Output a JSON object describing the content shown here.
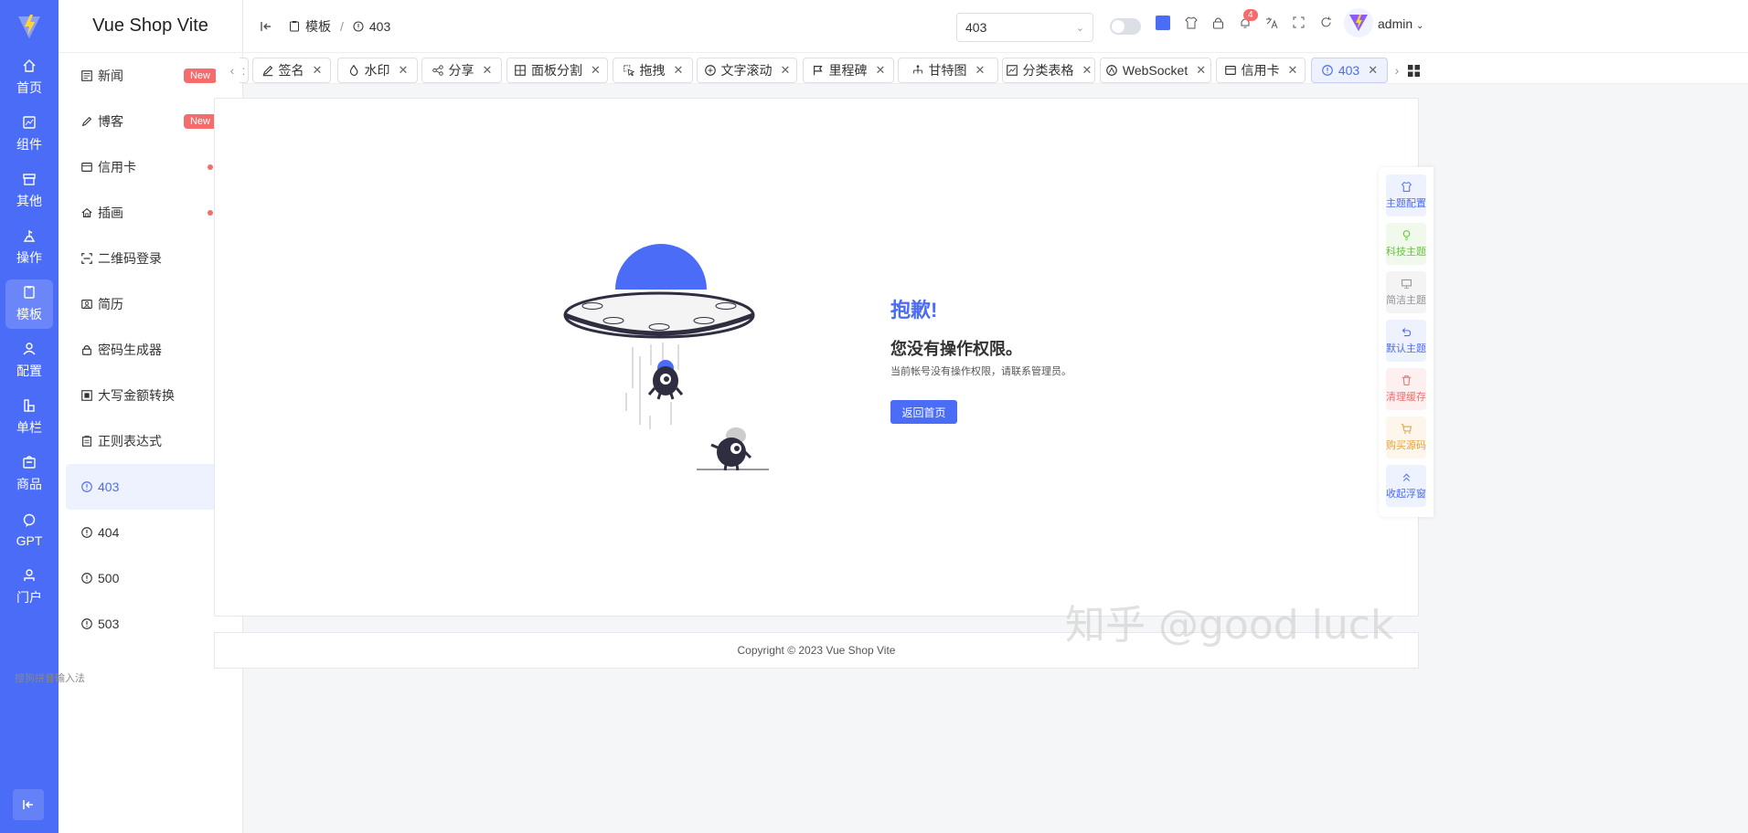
{
  "app": {
    "brand": "Vue Shop Vite"
  },
  "rail": {
    "items": [
      {
        "label": "首页",
        "icon": "home-icon"
      },
      {
        "label": "组件",
        "icon": "component-icon"
      },
      {
        "label": "其他",
        "icon": "archive-icon"
      },
      {
        "label": "操作",
        "icon": "operate-icon"
      },
      {
        "label": "模板",
        "icon": "template-icon",
        "active": true
      },
      {
        "label": "配置",
        "icon": "user-config-icon"
      },
      {
        "label": "单栏",
        "icon": "column-icon"
      },
      {
        "label": "商品",
        "icon": "goods-icon"
      },
      {
        "label": "GPT",
        "icon": "chat-icon"
      },
      {
        "label": "门户",
        "icon": "portal-icon"
      }
    ]
  },
  "submenu": {
    "items": [
      {
        "label": "新闻",
        "badge": "New"
      },
      {
        "label": "博客",
        "badge": "New"
      },
      {
        "label": "信用卡",
        "dot": true
      },
      {
        "label": "插画",
        "dot": true
      },
      {
        "label": "二维码登录"
      },
      {
        "label": "简历"
      },
      {
        "label": "密码生成器"
      },
      {
        "label": "大写金额转换"
      },
      {
        "label": "正则表达式"
      },
      {
        "label": "403",
        "active": true
      },
      {
        "label": "404"
      },
      {
        "label": "500"
      },
      {
        "label": "503"
      }
    ]
  },
  "header": {
    "breadcrumb": [
      "模板",
      "403"
    ],
    "search_value": "403",
    "notification_count": "4",
    "user": "admin"
  },
  "tabs": [
    "签名",
    "水印",
    "分享",
    "面板分割",
    "拖拽",
    "文字滚动",
    "里程碑",
    "甘特图",
    "分类表格",
    "WebSocket",
    "信用卡",
    "403"
  ],
  "error": {
    "title": "抱歉!",
    "subtitle": "您没有操作权限。",
    "description": "当前帐号没有操作权限，请联系管理员。",
    "button": "返回首页"
  },
  "footer": {
    "copyright": "Copyright © 2023 Vue Shop Vite"
  },
  "float_panel": [
    {
      "label": "主题配置",
      "color": "#4a6cf7",
      "bg": "#eef1fe"
    },
    {
      "label": "科技主题",
      "color": "#67c23a",
      "bg": "#f0f9eb"
    },
    {
      "label": "简洁主题",
      "color": "#909399",
      "bg": "#f4f4f5"
    },
    {
      "label": "默认主题",
      "color": "#4a6cf7",
      "bg": "#eef1fe"
    },
    {
      "label": "清理缓存",
      "color": "#f56c6c",
      "bg": "#fef0f0"
    },
    {
      "label": "购买源码",
      "color": "#e6a23c",
      "bg": "#fdf6ec"
    },
    {
      "label": "收起浮窗",
      "color": "#4a6cf7",
      "bg": "#eef1fe"
    }
  ],
  "watermark": "知乎 @good luck",
  "ime": "搜狗拼音输入法"
}
